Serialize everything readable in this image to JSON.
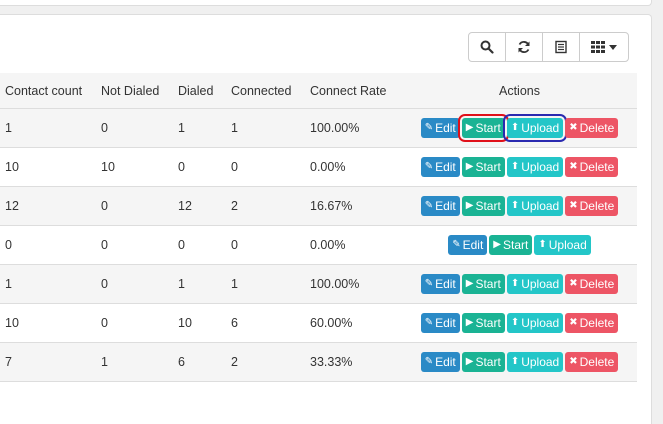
{
  "toolbar": {
    "icons": [
      "search-icon",
      "refresh-icon",
      "list-icon",
      "columns-icon"
    ]
  },
  "table": {
    "headers": [
      "Contact count",
      "Not Dialed",
      "Dialed",
      "Connected",
      "Connect Rate",
      "Actions"
    ],
    "buttons": {
      "edit": "Edit",
      "start": "Start",
      "upload": "Upload",
      "delete": "Delete"
    },
    "rows": [
      {
        "contact_count": "1",
        "not_dialed": "0",
        "dialed": "1",
        "connected": "1",
        "connect_rate": "100.00%"
      },
      {
        "contact_count": "10",
        "not_dialed": "10",
        "dialed": "0",
        "connected": "0",
        "connect_rate": "0.00%"
      },
      {
        "contact_count": "12",
        "not_dialed": "0",
        "dialed": "12",
        "connected": "2",
        "connect_rate": "16.67%"
      },
      {
        "contact_count": "0",
        "not_dialed": "0",
        "dialed": "0",
        "connected": "0",
        "connect_rate": "0.00%"
      },
      {
        "contact_count": "1",
        "not_dialed": "0",
        "dialed": "1",
        "connected": "1",
        "connect_rate": "100.00%"
      },
      {
        "contact_count": "10",
        "not_dialed": "0",
        "dialed": "10",
        "connected": "6",
        "connect_rate": "60.00%"
      },
      {
        "contact_count": "7",
        "not_dialed": "1",
        "dialed": "6",
        "connected": "2",
        "connect_rate": "33.33%"
      }
    ]
  },
  "colors": {
    "edit": "#2a8ac6",
    "start": "#1ab394",
    "upload": "#23c6c8",
    "delete": "#ed5565",
    "highlight_start": "#e0101a",
    "highlight_upload": "#2a2ab0"
  }
}
